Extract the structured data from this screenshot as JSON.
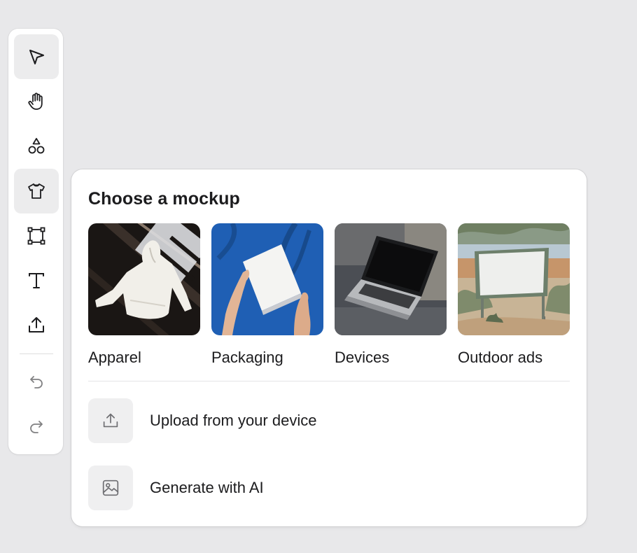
{
  "toolbar": {
    "tools": [
      {
        "id": "select",
        "icon": "cursor-icon",
        "active": true
      },
      {
        "id": "hand",
        "icon": "hand-icon",
        "active": false
      },
      {
        "id": "shapes",
        "icon": "shapes-icon",
        "active": false
      },
      {
        "id": "mockup",
        "icon": "tshirt-icon",
        "active": true
      },
      {
        "id": "frame",
        "icon": "frame-icon",
        "active": false
      },
      {
        "id": "text",
        "icon": "text-icon",
        "active": false
      },
      {
        "id": "upload",
        "icon": "upload-icon",
        "active": false
      },
      {
        "id": "undo",
        "icon": "undo-icon",
        "active": false
      },
      {
        "id": "redo",
        "icon": "redo-icon",
        "active": false
      }
    ]
  },
  "panel": {
    "title": "Choose a mockup",
    "mockups": [
      {
        "label": "Apparel",
        "image": "white-hoodie-photo"
      },
      {
        "label": "Packaging",
        "image": "white-box-photo"
      },
      {
        "label": "Devices",
        "image": "laptop-photo"
      },
      {
        "label": "Outdoor ads",
        "image": "billboard-photo"
      }
    ],
    "actions": [
      {
        "label": "Upload from your device",
        "icon": "upload-icon"
      },
      {
        "label": "Generate with AI",
        "icon": "image-icon"
      }
    ]
  },
  "colors": {
    "background": "#e8e8ea",
    "surface": "#ffffff",
    "active_tool": "#ececed",
    "icon_tile": "#efeff0"
  }
}
